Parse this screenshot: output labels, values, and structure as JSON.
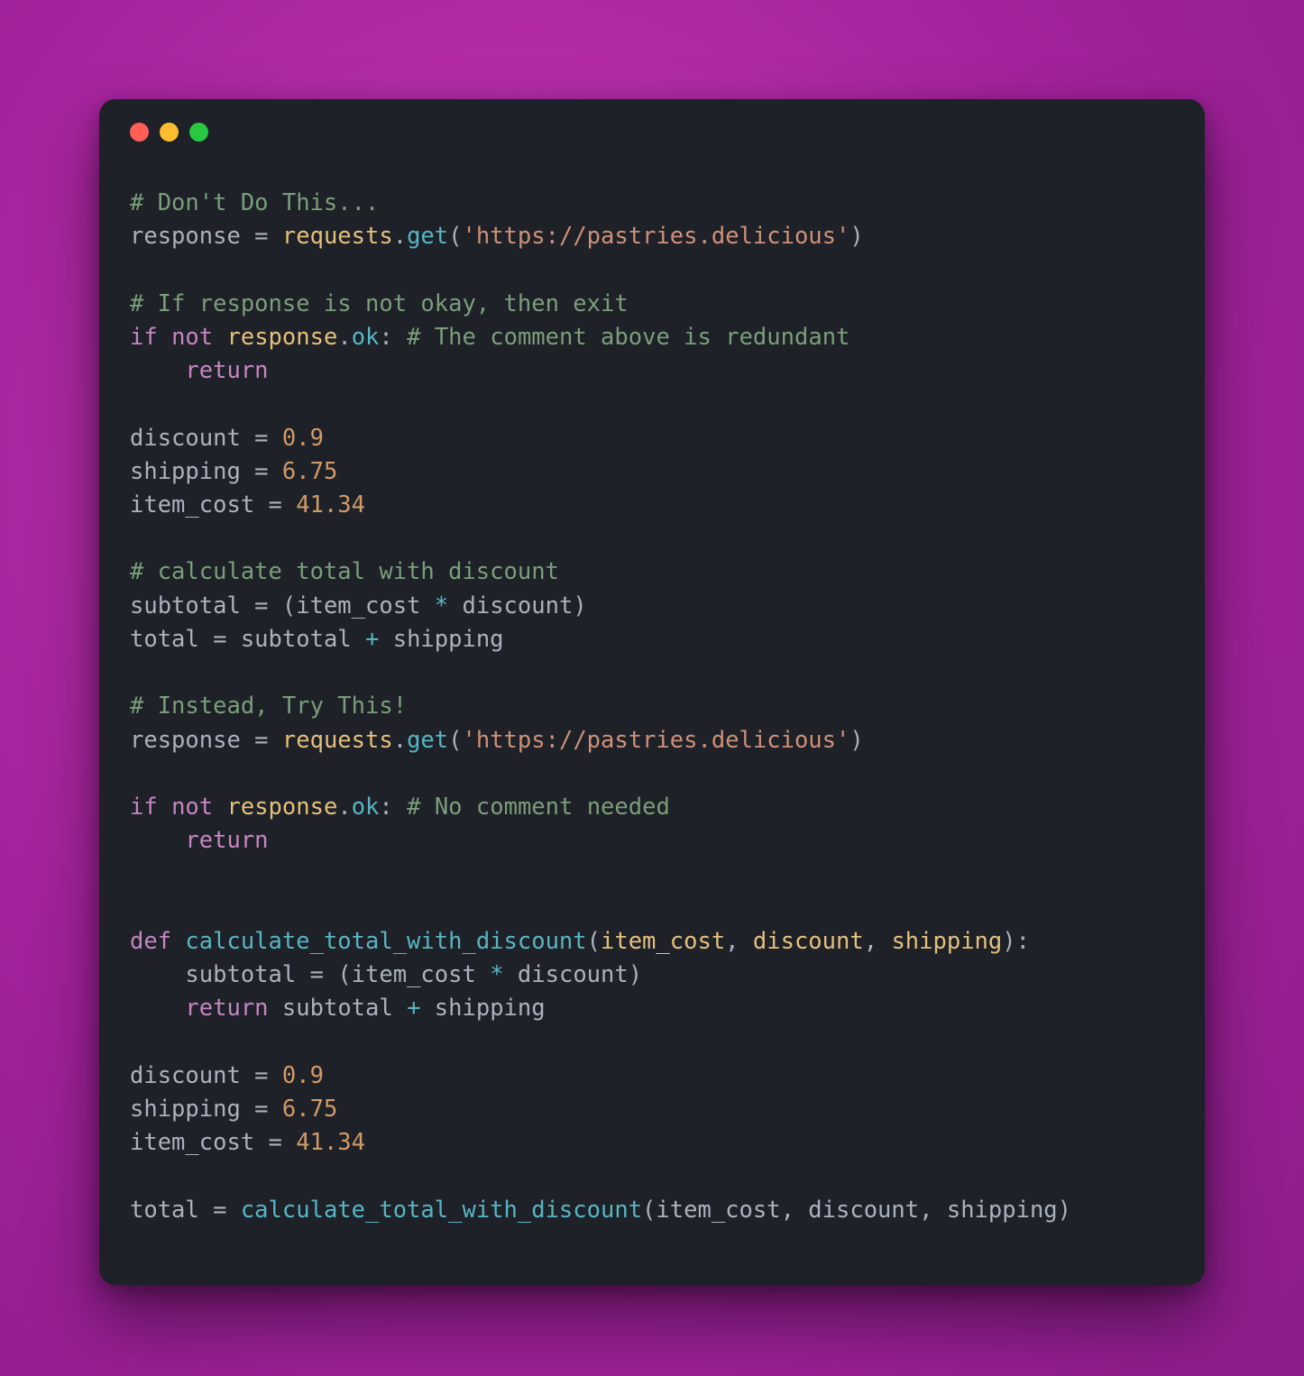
{
  "colors": {
    "bg_gradient_center": "#c93ab3",
    "bg_gradient_edge": "#8b1c8a",
    "window_bg": "#1e2128",
    "comment": "#7a9e7a",
    "keyword": "#c586c0",
    "call": "#56b6c2",
    "string": "#ce9178",
    "number": "#d19a66",
    "identifier": "#e5c07b",
    "plain": "#abb2bf"
  },
  "traffic_lights": {
    "red": "#ff5f57",
    "yellow": "#febc2e",
    "green": "#28c840"
  },
  "code": {
    "line01_comment": "# Don't Do This...",
    "line02_assign_target": "response",
    "line02_eq": " = ",
    "line02_obj": "requests",
    "line02_dot": ".",
    "line02_method": "get",
    "line02_lparen": "(",
    "line02_str": "'https://pastries.delicious'",
    "line02_rparen": ")",
    "line04_comment": "# If response is not okay, then exit",
    "line05_if": "if",
    "line05_sp1": " ",
    "line05_not": "not",
    "line05_sp2": " ",
    "line05_obj": "response",
    "line05_dot": ".",
    "line05_attr": "ok",
    "line05_colon": ":",
    "line05_sp3": " ",
    "line05_comment": "# The comment above is redundant",
    "line06_indent": "    ",
    "line06_return": "return",
    "line08_discount_lhs": "discount",
    "line08_eq": " = ",
    "line08_val": "0.9",
    "line09_shipping_lhs": "shipping",
    "line09_eq": " = ",
    "line09_val": "6.75",
    "line10_itemcost_lhs": "item_cost",
    "line10_eq": " = ",
    "line10_val": "41.34",
    "line12_comment": "# calculate total with discount",
    "line13_lhs": "subtotal",
    "line13_eq": " = ",
    "line13_lparen": "(",
    "line13_a": "item_cost",
    "line13_op": " * ",
    "line13_b": "discount",
    "line13_rparen": ")",
    "line14_lhs": "total",
    "line14_eq": " = ",
    "line14_a": "subtotal",
    "line14_op": " + ",
    "line14_b": "shipping",
    "line16_comment": "# Instead, Try This!",
    "line17_assign_target": "response",
    "line17_eq": " = ",
    "line17_obj": "requests",
    "line17_dot": ".",
    "line17_method": "get",
    "line17_lparen": "(",
    "line17_str": "'https://pastries.delicious'",
    "line17_rparen": ")",
    "line19_if": "if",
    "line19_sp1": " ",
    "line19_not": "not",
    "line19_sp2": " ",
    "line19_obj": "response",
    "line19_dot": ".",
    "line19_attr": "ok",
    "line19_colon": ":",
    "line19_sp3": " ",
    "line19_comment": "# No comment needed",
    "line20_indent": "    ",
    "line20_return": "return",
    "line23_def": "def",
    "line23_sp": " ",
    "line23_name": "calculate_total_with_discount",
    "line23_lparen": "(",
    "line23_p1": "item_cost",
    "line23_c1": ", ",
    "line23_p2": "discount",
    "line23_c2": ", ",
    "line23_p3": "shipping",
    "line23_rparen": ")",
    "line23_colon": ":",
    "line24_indent": "    ",
    "line24_lhs": "subtotal",
    "line24_eq": " = ",
    "line24_lparen": "(",
    "line24_a": "item_cost",
    "line24_op": " * ",
    "line24_b": "discount",
    "line24_rparen": ")",
    "line25_indent": "    ",
    "line25_return": "return",
    "line25_sp": " ",
    "line25_a": "subtotal",
    "line25_op": " + ",
    "line25_b": "shipping",
    "line27_discount_lhs": "discount",
    "line27_eq": " = ",
    "line27_val": "0.9",
    "line28_shipping_lhs": "shipping",
    "line28_eq": " = ",
    "line28_val": "6.75",
    "line29_itemcost_lhs": "item_cost",
    "line29_eq": " = ",
    "line29_val": "41.34",
    "line31_lhs": "total",
    "line31_eq": " = ",
    "line31_fn": "calculate_total_with_discount",
    "line31_lparen": "(",
    "line31_a1": "item_cost",
    "line31_c1": ", ",
    "line31_a2": "discount",
    "line31_c2": ", ",
    "line31_a3": "shipping",
    "line31_rparen": ")"
  }
}
